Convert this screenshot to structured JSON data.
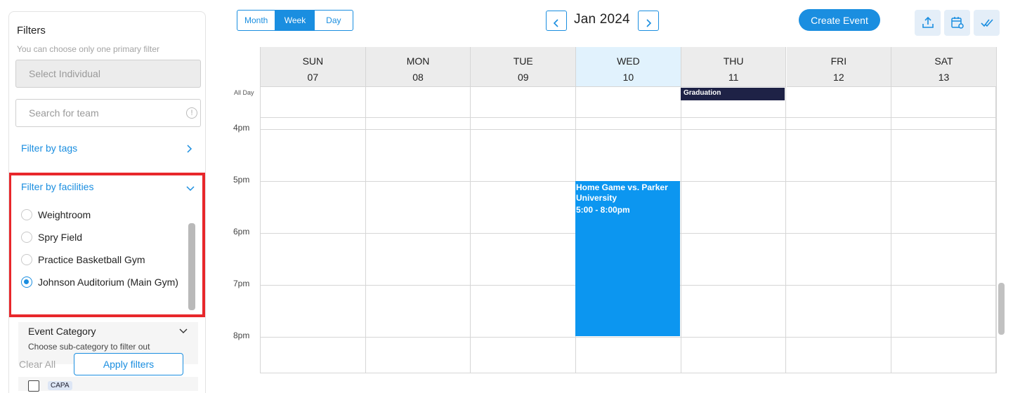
{
  "sidebar": {
    "title": "Filters",
    "subtitle": "You can choose only one primary filter",
    "select_individual": "Select Individual",
    "search_team_placeholder": "Search for team",
    "filter_tags": "Filter by tags",
    "filter_facilities": "Filter by facilities",
    "facilities": [
      {
        "label": "Weightroom",
        "selected": false
      },
      {
        "label": "Spry Field",
        "selected": false
      },
      {
        "label": "Practice Basketball Gym",
        "selected": false
      },
      {
        "label": "Johnson Auditorium (Main Gym)",
        "selected": true
      }
    ],
    "event_category": {
      "title": "Event Category",
      "subtitle": "Choose sub-category to filter out"
    },
    "clear_all": "Clear All",
    "apply_filters": "Apply filters",
    "cut_badge": "CAPA"
  },
  "header": {
    "views": [
      "Month",
      "Week",
      "Day"
    ],
    "active_view": "Week",
    "month_label": "Jan 2024",
    "create_event": "Create Event",
    "icons": [
      "upload-icon",
      "calendar-settings-icon",
      "double-check-icon"
    ]
  },
  "calendar": {
    "days": [
      {
        "name": "SUN",
        "num": "07"
      },
      {
        "name": "MON",
        "num": "08"
      },
      {
        "name": "TUE",
        "num": "09"
      },
      {
        "name": "WED",
        "num": "10",
        "today": true
      },
      {
        "name": "THU",
        "num": "11"
      },
      {
        "name": "FRI",
        "num": "12"
      },
      {
        "name": "SAT",
        "num": "13"
      }
    ],
    "all_day_label": "All Day",
    "times": [
      "4pm",
      "5pm",
      "6pm",
      "7pm",
      "8pm"
    ],
    "events": {
      "graduation": {
        "title": "Graduation",
        "day": "THU",
        "all_day": true,
        "color": "#1e2246"
      },
      "home_game": {
        "title": "Home Game vs. Parker University",
        "time": "5:00 - 8:00pm",
        "day": "WED",
        "color": "#0c96f0"
      }
    }
  },
  "colors": {
    "accent": "#1a8ee0",
    "highlight_border": "#e8272b",
    "today_header": "#e1f2fd"
  }
}
